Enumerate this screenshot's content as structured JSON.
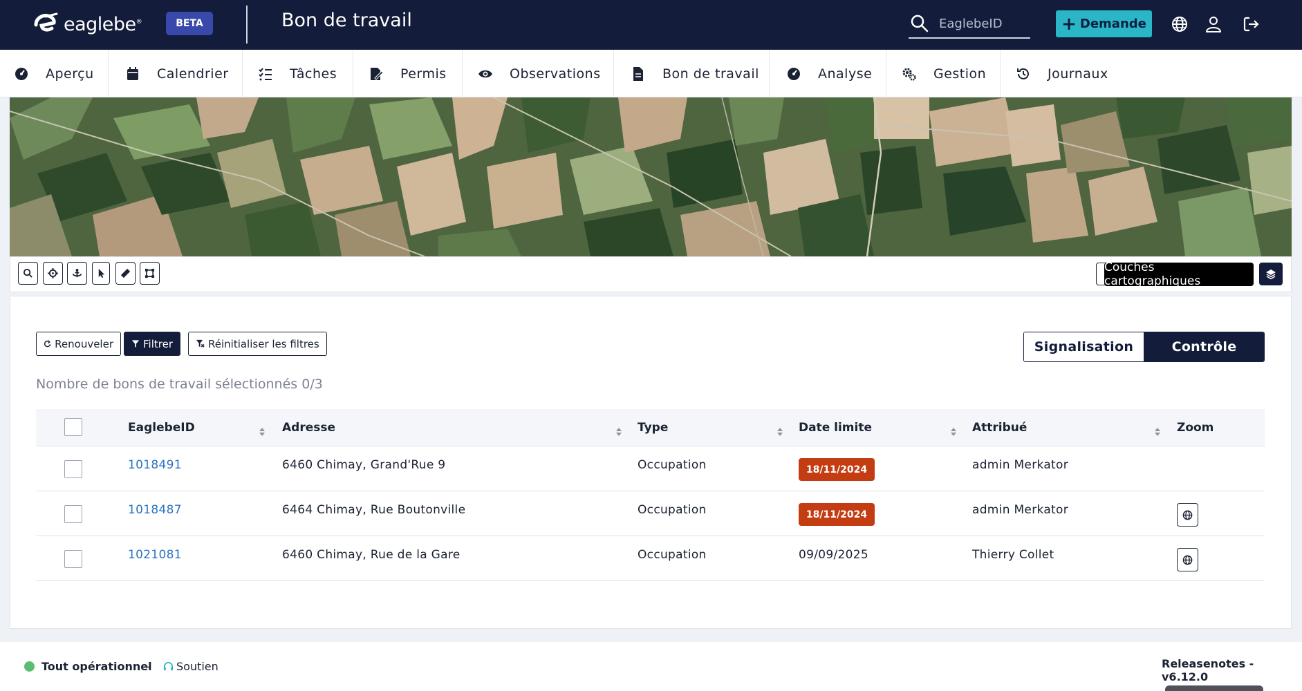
{
  "header": {
    "brand": "eaglebe",
    "brand_mark": "®",
    "beta": "BETA",
    "page_title": "Bon de travail",
    "search_placeholder": "EaglebeID",
    "demande_label": "Demande",
    "icons": [
      "search-icon",
      "globe-icon",
      "user-icon",
      "logout-icon"
    ]
  },
  "nav": {
    "items": [
      {
        "label": "Aperçu",
        "icon": "dashboard-icon"
      },
      {
        "label": "Calendrier",
        "icon": "calendar-icon"
      },
      {
        "label": "Tâches",
        "icon": "tasks-icon"
      },
      {
        "label": "Permis",
        "icon": "permit-icon"
      },
      {
        "label": "Observations",
        "icon": "eye-icon"
      },
      {
        "label": "Bon de travail",
        "icon": "document-icon"
      },
      {
        "label": "Analyse",
        "icon": "analysis-icon"
      },
      {
        "label": "Gestion",
        "icon": "cogs-icon"
      },
      {
        "label": "Journaux",
        "icon": "history-icon"
      }
    ]
  },
  "map": {
    "tooltip": "Couches cartographiques",
    "tools": [
      "search-icon",
      "crosshair-icon",
      "anchor-icon",
      "pointer-icon",
      "ruler-icon",
      "polygon-icon"
    ]
  },
  "actions": {
    "renew": "Renouveler",
    "filter": "Filtrer",
    "reset": "Réinitialiser les filtres"
  },
  "toggle": {
    "signalisation": "Signalisation",
    "controle": "Contrôle",
    "active": "Contrôle"
  },
  "selection_count": "Nombre de bons de travail sélectionnés 0/3",
  "table": {
    "headers": {
      "id": "EaglebeID",
      "address": "Adresse",
      "type": "Type",
      "deadline": "Date limite",
      "assigned": "Attribué",
      "zoom": "Zoom"
    },
    "rows": [
      {
        "id": "1018491",
        "address": "6460 Chimay, Grand'Rue 9",
        "type": "Occupation",
        "deadline": "18/11/2024",
        "overdue": true,
        "assigned": "admin Merkator",
        "zoom": false
      },
      {
        "id": "1018487",
        "address": "6464 Chimay, Rue Boutonville",
        "type": "Occupation",
        "deadline": "18/11/2024",
        "overdue": true,
        "assigned": "admin Merkator",
        "zoom": true
      },
      {
        "id": "1021081",
        "address": "6460 Chimay, Rue de la Gare",
        "type": "Occupation",
        "deadline": "09/09/2025",
        "overdue": false,
        "assigned": "Thierry Collet",
        "zoom": true
      }
    ]
  },
  "footer": {
    "status": "Tout opérationnel",
    "separator": "-",
    "support": "Soutien",
    "release": "Releasenotes - v6.12.0"
  },
  "colors": {
    "navy": "#131c3a",
    "accent": "#2bb6c8",
    "beta": "#3949ab",
    "overdue": "#c43d12",
    "link": "#2b73c2",
    "status_ok": "#5cbd6e"
  }
}
